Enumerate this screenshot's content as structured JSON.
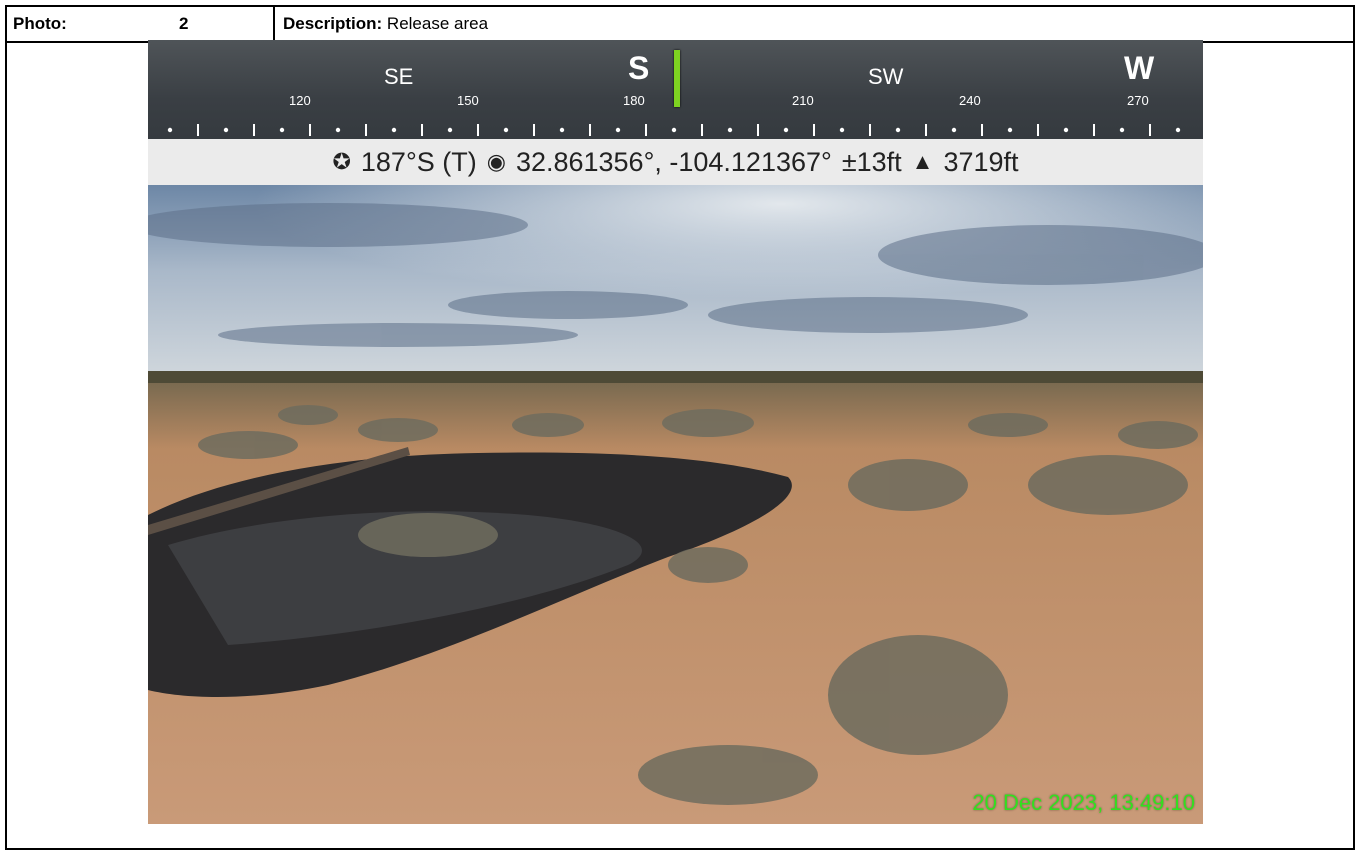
{
  "header": {
    "photo_label": "Photo:",
    "photo_number": "2",
    "description_label": "Description:",
    "description_value": "Release area"
  },
  "compass": {
    "directions": [
      "SE",
      "S",
      "SW",
      "W"
    ],
    "tick_labels": [
      "120",
      "150",
      "180",
      "210",
      "240",
      "270"
    ],
    "heading_marker_color": "#7ed321"
  },
  "info": {
    "heading": "187°S (T)",
    "coordinates": "32.861356°, -104.121367°",
    "accuracy": "±13ft",
    "altitude": "3719ft"
  },
  "timestamp": "20 Dec 2023, 13:49:10",
  "colors": {
    "timestamp": "#32e01f",
    "compass_bg": "#3a3f44",
    "info_bg": "#ebebeb"
  },
  "icons": {
    "heading": "compass-rose-icon",
    "location": "location-dot-icon",
    "altitude": "triangle-up-icon"
  }
}
